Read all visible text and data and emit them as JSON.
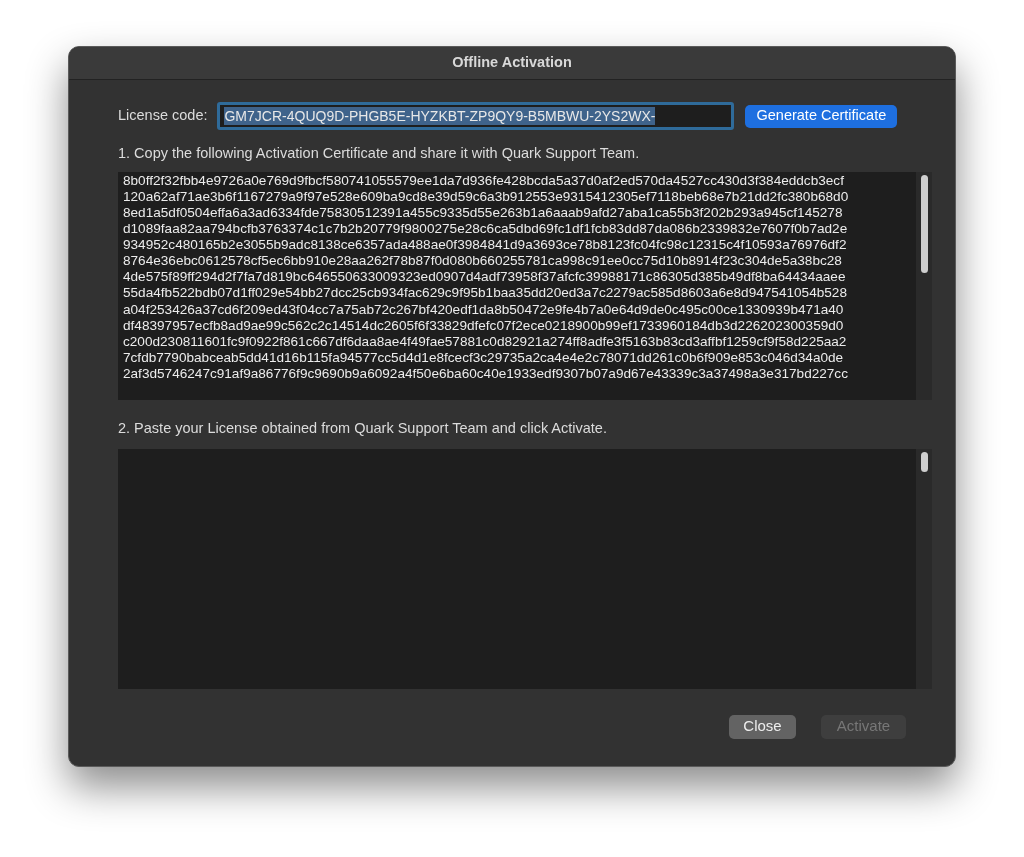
{
  "window": {
    "title": "Offline Activation"
  },
  "license": {
    "label": "License code:",
    "value": "GM7JCR-4QUQ9D-PHGB5E-HYZKBT-ZP9QY9-B5MBWU-2YS2WX-",
    "generate_button": "Generate Certificate"
  },
  "step_1": "1. Copy the following Activation Certificate and share it with Quark Support Team.",
  "certificate_lines": [
    "8b0ff2f32fbb4e9726a0e769d9fbcf580741055579ee1da7d936fe428bcda5a37d0af2ed570da4527cc430d3f384eddcb3ecf",
    "120a62af71ae3b6f1167279a9f97e528e609ba9cd8e39d59c6a3b912553e9315412305ef7118beb68e7b21dd2fc380b68d0",
    "8ed1a5df0504effa6a3ad6334fde75830512391a455c9335d55e263b1a6aaab9afd27aba1ca55b3f202b293a945cf145278",
    "d1089faa82aa794bcfb3763374c1c7b2b20779f9800275e28c6ca5dbd69fc1df1fcb83dd87da086b2339832e7607f0b7ad2e",
    "934952c480165b2e3055b9adc8138ce6357ada488ae0f3984841d9a3693ce78b8123fc04fc98c12315c4f10593a76976df2",
    "8764e36ebc0612578cf5ec6bb910e28aa262f78b87f0d080b660255781ca998c91ee0cc75d10b8914f23c304de5a38bc28",
    "4de575f89ff294d2f7fa7d819bc646550633009323ed0907d4adf73958f37afcfc39988171c86305d385b49df8ba64434aaee",
    "55da4fb522bdb07d1ff029e54bb27dcc25cb934fac629c9f95b1baa35dd20ed3a7c2279ac585d8603a6e8d947541054b528",
    "a04f253426a37cd6f209ed43f04cc7a75ab72c267bf420edf1da8b50472e9fe4b7a0e64d9de0c495c00ce1330939b471a40",
    "df48397957ecfb8ad9ae99c562c2c14514dc2605f6f33829dfefc07f2ece0218900b99ef1733960184db3d226202300359d0",
    "c200d230811601fc9f0922f861c667df6daa8ae4f49fae57881c0d82921a274ff8adfe3f5163b83cd3affbf1259cf9f58d225aa2",
    "7cfdb7790babceab5dd41d16b115fa94577cc5d4d1e8fcecf3c29735a2ca4e4e2c78071dd261c0b6f909e853c046d34a0de",
    "2af3d5746247c91af9a86776f9c9690b9a6092a4f50e6ba60c40e1933edf9307b07a9d67e43339c3a37498a3e317bd227cc"
  ],
  "step_2": "2. Paste your License obtained from Quark Support Team and click Activate.",
  "buttons": [
    {
      "label": "Close",
      "disabled": false
    },
    {
      "label": "Activate",
      "disabled": true
    }
  ]
}
